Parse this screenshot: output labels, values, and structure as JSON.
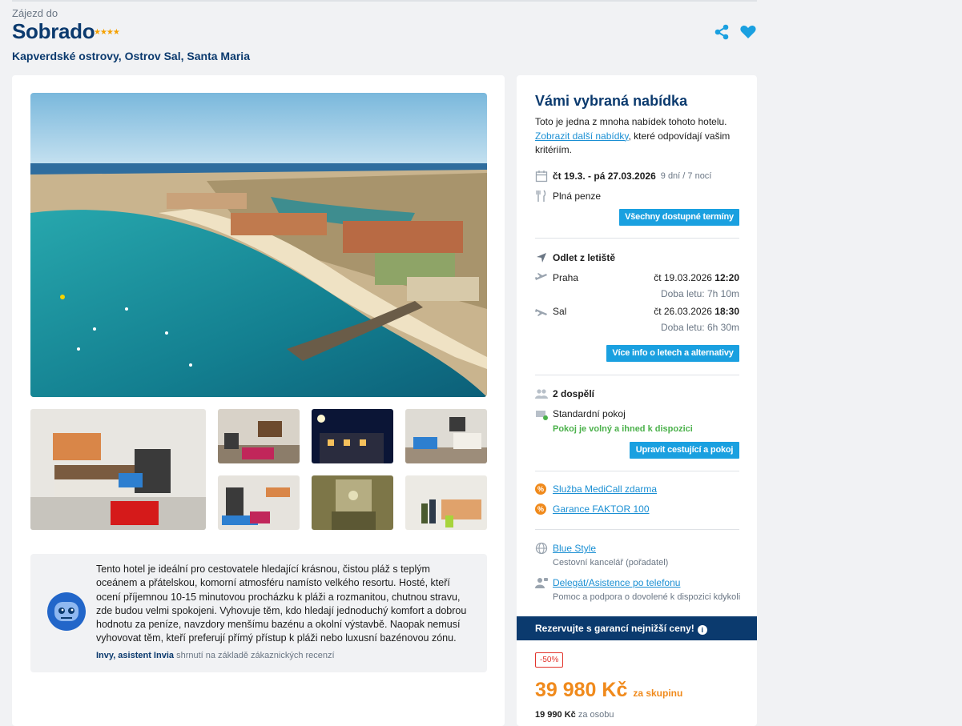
{
  "header": {
    "pretitle": "Zájezd do",
    "title": "Sobrado",
    "stars": "★★★★",
    "location": "Kapverdské ostrovy, Ostrov Sal, Santa Maria"
  },
  "assistant": {
    "text": "Tento hotel je ideální pro cestovatele hledající krásnou, čistou pláž s teplým oceánem a přátelskou, komorní atmosféru namísto velkého resortu. Hosté, kteří ocení příjemnou 10-15 minutovou procházku k pláži a rozmanitou, chutnou stravu, zde budou velmi spokojeni. Vyhovuje těm, kdo hledají jednoduchý komfort a dobrou hodnotu za peníze, navzdory menšímu bazénu a okolní výstavbě. Naopak nemusí vyhovovat těm, kteří preferují přímý přístup k pláži nebo luxusní bazénovou zónu.",
    "author": "Invy, asistent Invia",
    "author_note": "shrnutí na základě zákaznických recenzí"
  },
  "offer": {
    "title": "Vámi vybraná nabídka",
    "intro_before": "Toto je jedna z mnoha nabídek tohoto hotelu.",
    "intro_link": "Zobrazit další nabídky",
    "intro_after": ", které odpovídají vašim kritériím.",
    "dates": "čt 19.3. - pá 27.03.2026",
    "duration": "9 dní / 7 nocí",
    "board": "Plná penze",
    "terms_button": "Všechny dostupné termíny"
  },
  "flights": {
    "heading": "Odlet z letiště",
    "outbound": {
      "airport": "Praha",
      "date": "čt 19.03.2026",
      "time": "12:20",
      "duration": "Doba letu: 7h 10m"
    },
    "inbound": {
      "airport": "Sal",
      "date": "čt 26.03.2026",
      "time": "18:30",
      "duration": "Doba letu: 6h 30m"
    },
    "more_button": "Více info o letech a alternativy"
  },
  "room": {
    "travellers": "2 dospělí",
    "type": "Standardní pokoj",
    "availability": "Pokoj je volný a ihned k dispozici",
    "edit_button": "Upravit cestující a pokoj"
  },
  "services": {
    "medicall": "Služba MediCall zdarma",
    "faktor": "Garance FAKTOR 100"
  },
  "agency": {
    "name": "Blue Style",
    "name_note": "Cestovní kancelář (pořadatel)",
    "delegate": "Delegát/Asistence po telefonu",
    "delegate_note": "Pomoc a podpora o dovolené k dispozici kdykoli"
  },
  "booking": {
    "guarantee": "Rezervujte s garancí nejnižší ceny!",
    "discount": "-50%",
    "price": "39 980 Kč",
    "price_note": "za skupinu",
    "per_person": "19 990 Kč",
    "per_person_note": "za osobu"
  },
  "colors": {
    "brand_navy": "#0b3a6e",
    "accent_blue": "#1aa0e0",
    "price_orange": "#f08a1c",
    "available_green": "#4bb14b",
    "discount_red": "#e2342c"
  }
}
